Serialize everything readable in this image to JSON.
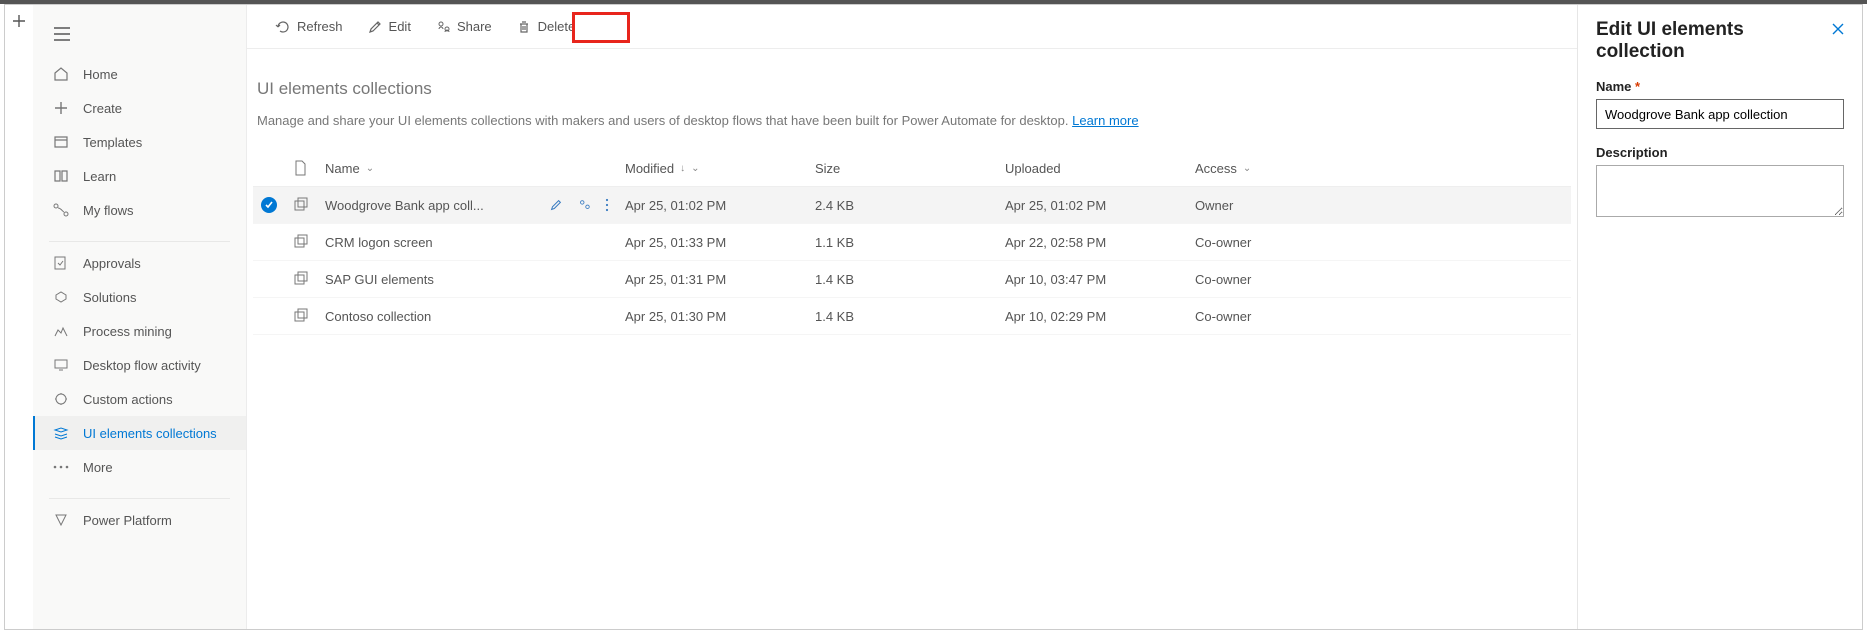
{
  "nav": {
    "home": "Home",
    "create": "Create",
    "templates": "Templates",
    "learn": "Learn",
    "myflows": "My flows",
    "approvals": "Approvals",
    "solutions": "Solutions",
    "processmining": "Process mining",
    "desktopflow": "Desktop flow activity",
    "customactions": "Custom actions",
    "uielements": "UI elements collections",
    "more": "More",
    "powerplatform": "Power Platform"
  },
  "toolbar": {
    "refresh": "Refresh",
    "edit": "Edit",
    "share": "Share",
    "delete": "Delete"
  },
  "page": {
    "title": "UI elements collections",
    "description": "Manage and share your UI elements collections with makers and users of desktop flows that have been built for Power Automate for desktop. ",
    "learnmore": "Learn more"
  },
  "columns": {
    "name": "Name",
    "modified": "Modified",
    "size": "Size",
    "uploaded": "Uploaded",
    "access": "Access"
  },
  "rows": [
    {
      "name": "Woodgrove Bank app coll...",
      "modified": "Apr 25, 01:02 PM",
      "size": "2.4 KB",
      "uploaded": "Apr 25, 01:02 PM",
      "access": "Owner",
      "selected": true
    },
    {
      "name": "CRM logon screen",
      "modified": "Apr 25, 01:33 PM",
      "size": "1.1 KB",
      "uploaded": "Apr 22, 02:58 PM",
      "access": "Co-owner",
      "selected": false
    },
    {
      "name": "SAP GUI elements",
      "modified": "Apr 25, 01:31 PM",
      "size": "1.4 KB",
      "uploaded": "Apr 10, 03:47 PM",
      "access": "Co-owner",
      "selected": false
    },
    {
      "name": "Contoso collection",
      "modified": "Apr 25, 01:30 PM",
      "size": "1.4 KB",
      "uploaded": "Apr 10, 02:29 PM",
      "access": "Co-owner",
      "selected": false
    }
  ],
  "panel": {
    "title": "Edit UI elements collection",
    "name_label": "Name",
    "name_value": "Woodgrove Bank app collection",
    "desc_label": "Description",
    "desc_value": ""
  }
}
